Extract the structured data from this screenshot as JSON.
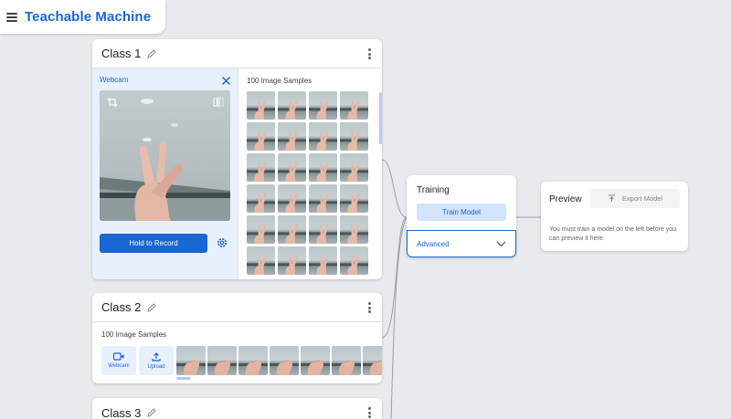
{
  "app": {
    "title": "Teachable Machine"
  },
  "classes": [
    {
      "title": "Class 1",
      "webcam_label": "Webcam",
      "record_label": "Hold to Record",
      "samples_label": "100 Image Samples"
    },
    {
      "title": "Class 2",
      "samples_label": "100 Image Samples",
      "webcam_button_label": "Webcam",
      "upload_button_label": "Upload"
    },
    {
      "title": "Class 3"
    }
  ],
  "training": {
    "title": "Training",
    "train_label": "Train Model",
    "advanced_label": "Advanced"
  },
  "preview": {
    "title": "Preview",
    "export_label": "Export Model",
    "message": "You must train a model on the left before you can preview it here."
  },
  "colors": {
    "accent": "#1967d2",
    "accent_light": "#e8f0fe",
    "background": "#e8eaed"
  }
}
